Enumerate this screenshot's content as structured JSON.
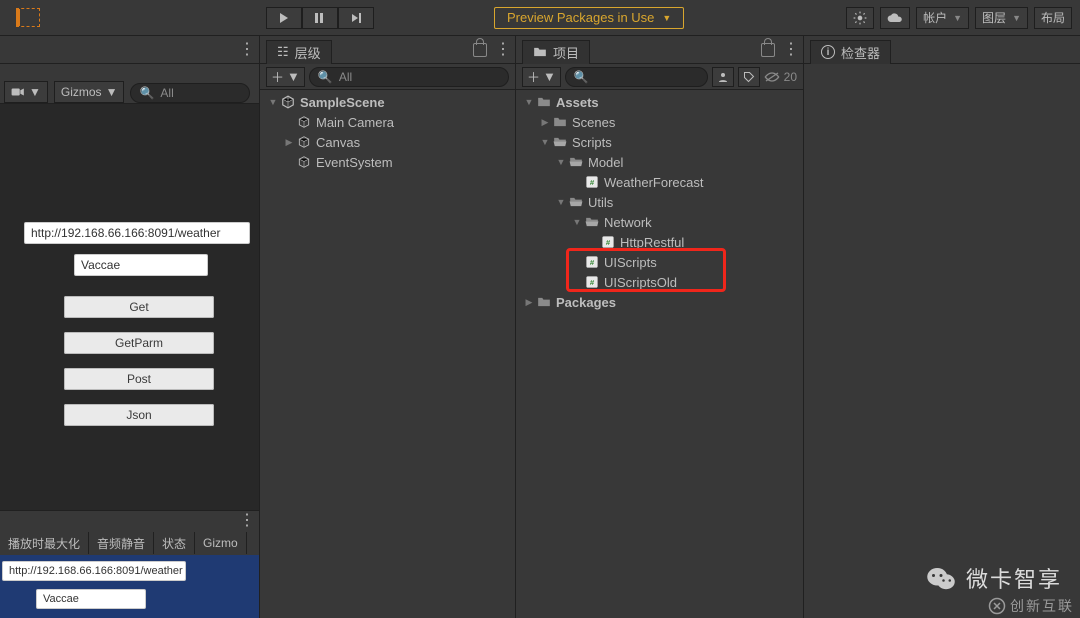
{
  "toolbar": {
    "preview_label": "Preview Packages in Use",
    "account_label": "帐户",
    "layers_label": "图层",
    "layout_label": "布局"
  },
  "scene": {
    "gizmos_label": "Gizmos",
    "search_placeholder": "All",
    "url": "http://192.168.66.166:8091/weather",
    "name_value": "Vaccae",
    "btn_get": "Get",
    "btn_getparm": "GetParm",
    "btn_post": "Post",
    "btn_json": "Json",
    "game_tabs": [
      "播放时最大化",
      "音频静音",
      "状态",
      "Gizmo"
    ],
    "game_url": "http://192.168.66.166:8091/weather",
    "game_name": "Vaccae"
  },
  "hierarchy": {
    "title": "层级",
    "search_placeholder": "All",
    "items": [
      {
        "label": "SampleScene",
        "depth": 0,
        "bold": true,
        "arrow": "open",
        "icon": "unity"
      },
      {
        "label": "Main Camera",
        "depth": 1,
        "arrow": "none",
        "icon": "cube"
      },
      {
        "label": "Canvas",
        "depth": 1,
        "arrow": "closed",
        "icon": "cube"
      },
      {
        "label": "EventSystem",
        "depth": 1,
        "arrow": "none",
        "icon": "cube"
      }
    ]
  },
  "project": {
    "title": "项目",
    "hidden_count": "20",
    "tree": [
      {
        "label": "Assets",
        "depth": 0,
        "bold": true,
        "arrow": "open",
        "icon": "folder"
      },
      {
        "label": "Scenes",
        "depth": 1,
        "arrow": "closed",
        "icon": "folder"
      },
      {
        "label": "Scripts",
        "depth": 1,
        "arrow": "open",
        "icon": "folder-open"
      },
      {
        "label": "Model",
        "depth": 2,
        "arrow": "open",
        "icon": "folder-open"
      },
      {
        "label": "WeatherForecast",
        "depth": 3,
        "arrow": "none",
        "icon": "cs"
      },
      {
        "label": "Utils",
        "depth": 2,
        "arrow": "open",
        "icon": "folder-open"
      },
      {
        "label": "Network",
        "depth": 3,
        "arrow": "open",
        "icon": "folder-open"
      },
      {
        "label": "HttpRestful",
        "depth": 4,
        "arrow": "none",
        "icon": "cs"
      },
      {
        "label": "UIScripts",
        "depth": 3,
        "arrow": "none",
        "icon": "cs",
        "hl": true
      },
      {
        "label": "UIScriptsOld",
        "depth": 3,
        "arrow": "none",
        "icon": "cs",
        "hl": true
      },
      {
        "label": "Packages",
        "depth": 0,
        "bold": true,
        "arrow": "closed",
        "icon": "folder"
      }
    ]
  },
  "inspector": {
    "title": "检查器"
  },
  "watermark": {
    "name": "微卡智享",
    "corp": "创新互联"
  }
}
